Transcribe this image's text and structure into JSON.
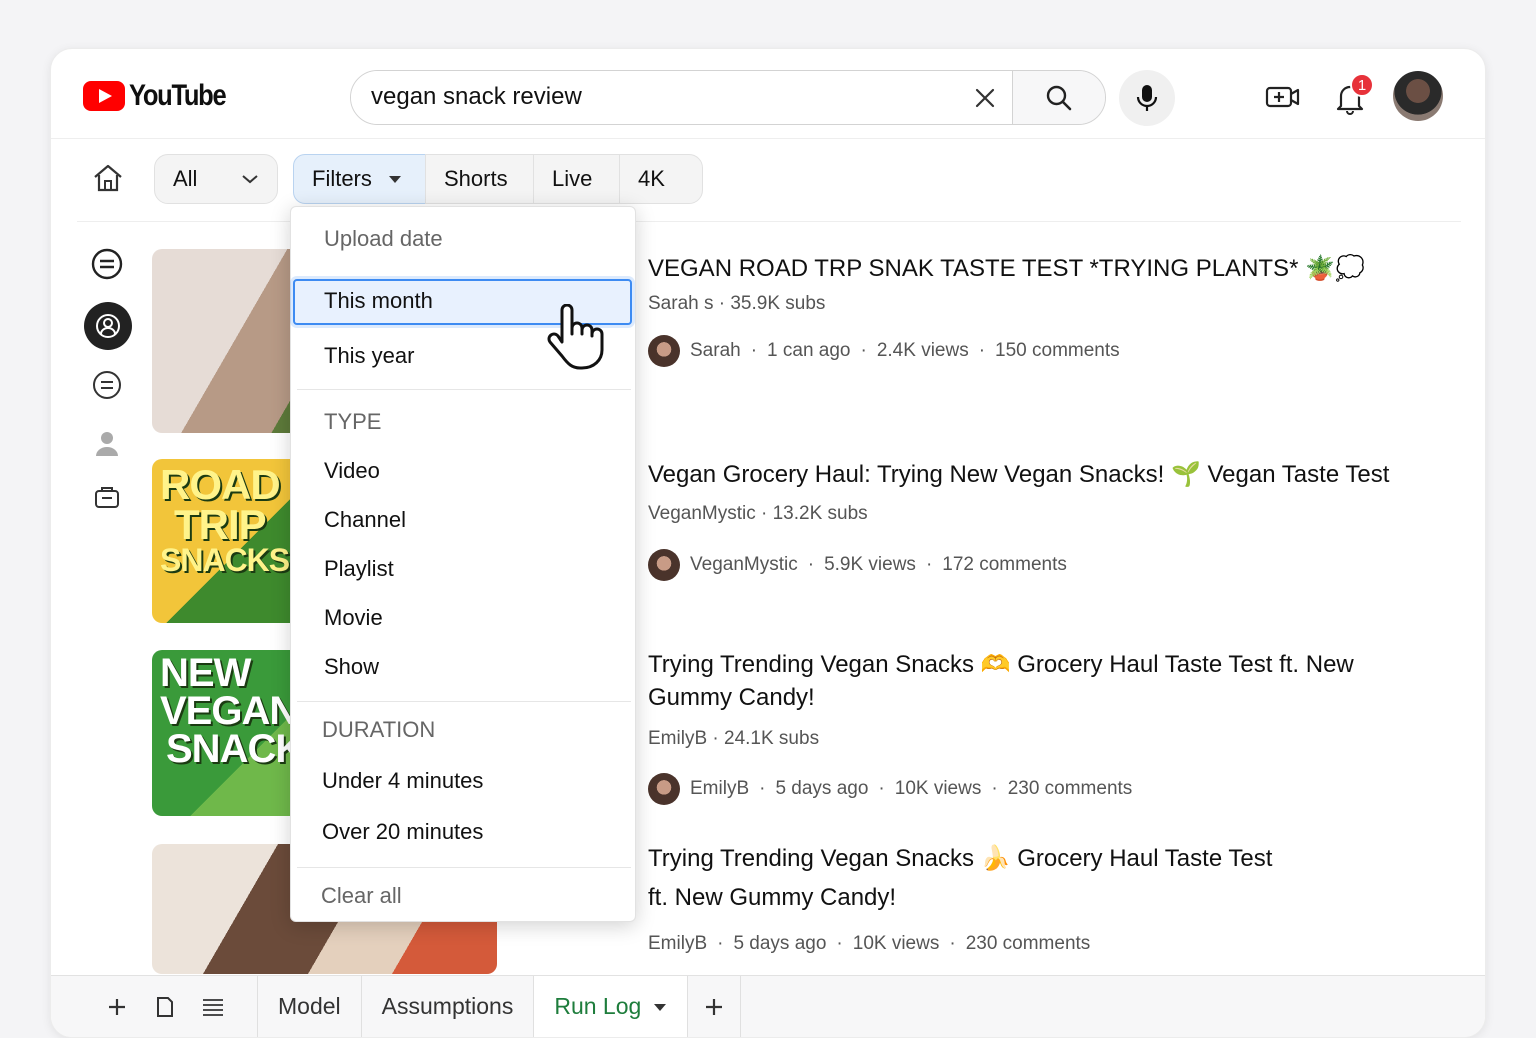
{
  "header": {
    "logo_text": "YouTube",
    "search_value": "vegan snack review",
    "notification_count": "1"
  },
  "chips": {
    "all": "All",
    "filters": "Filters",
    "shorts": "Shorts",
    "live": "Live",
    "fourk": "4K"
  },
  "thumbnails": {
    "t2_text_1": "ROAD",
    "t2_text_2": "TRIP",
    "t2_text_3": "SNACKS",
    "t3_text_1": "NEW",
    "t3_text_2": "VEGAN",
    "t3_text_3": "SNACK"
  },
  "results": [
    {
      "title": "VEGAN ROAD TRP SNAK TASTE TEST *TRYING PLANTS* 🪴💭",
      "channel_line": "Sarah s · 35.9K subs",
      "author": "Sarah",
      "age": "1 can ago",
      "views": "2.4K views",
      "comments": "150 comments"
    },
    {
      "title": "Vegan Grocery Haul: Trying New Vegan Snacks! 🌱 Vegan Taste Test",
      "channel_line": "VeganMystic · 13.2K subs",
      "author": "VeganMystic",
      "views": "5.9K views",
      "comments": "172 comments"
    },
    {
      "title_line1": "Trying Trending Vegan Snacks 🫶 Grocery Haul Taste Test ft. New",
      "title_line2": "Gummy Candy!",
      "channel_line": "EmilyB · 24.1K subs",
      "author": "EmilyB",
      "age": "5 days ago",
      "views": "10K views",
      "comments": "230 comments"
    },
    {
      "title_line1": "Trying Trending Vegan Snacks 🍌 Grocery Haul Taste Test",
      "title_line2": "ft. New Gummy Candy!",
      "author": "EmilyB",
      "age": "5 days ago",
      "views": "10K views",
      "comments": "230 comments"
    }
  ],
  "dropdown": {
    "upload_date": "Upload date",
    "this_month": "This month",
    "this_year": "This year",
    "type_head": "TYPE",
    "video": "Video",
    "channel": "Channel",
    "playlist": "Playlist",
    "movie": "Movie",
    "show": "Show",
    "duration_head": "DURATION",
    "under_4": "Under 4 minutes",
    "over_20": "Over 20 minutes",
    "clear_all": "Clear all"
  },
  "tabs": {
    "model": "Model",
    "assumptions": "Assumptions",
    "run_log": "Run Log"
  },
  "colors": {
    "brand_red": "#ff0000",
    "selection_blue": "#3d8bf2",
    "active_tab_green": "#1e7d3c"
  }
}
